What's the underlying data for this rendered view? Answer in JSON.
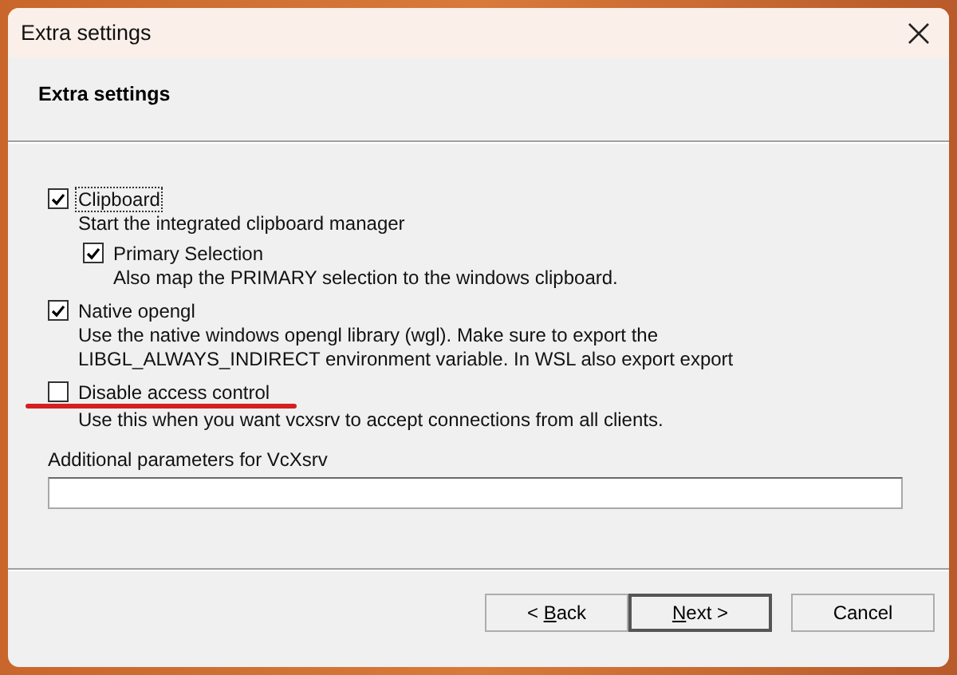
{
  "window": {
    "title": "Extra settings"
  },
  "header": {
    "title": "Extra settings"
  },
  "options": [
    {
      "label": "Clipboard",
      "checked": true,
      "focused": true,
      "lines": [
        "Start the integrated clipboard manager"
      ],
      "children": [
        {
          "label": "Primary Selection",
          "checked": true,
          "focused": false,
          "lines": [
            "Also map the PRIMARY selection to the windows clipboard."
          ]
        }
      ]
    },
    {
      "label": "Native opengl",
      "checked": true,
      "focused": false,
      "lines": [
        "Use the native windows opengl library (wgl). Make sure to export the",
        "LIBGL_ALWAYS_INDIRECT environment variable. In WSL also export export"
      ]
    },
    {
      "label": "Disable access control",
      "checked": false,
      "focused": false,
      "marked": true,
      "lines": [
        "Use this when you want vcxsrv to accept connections from all clients."
      ]
    }
  ],
  "parameters": {
    "label": "Additional parameters for VcXsrv"
  },
  "buttons": [
    {
      "pre": "< ",
      "key": "B",
      "post": "ack",
      "default": false
    },
    {
      "key": "N",
      "post": "ext >",
      "default": true
    },
    {
      "post": "Cancel",
      "default": false
    }
  ]
}
